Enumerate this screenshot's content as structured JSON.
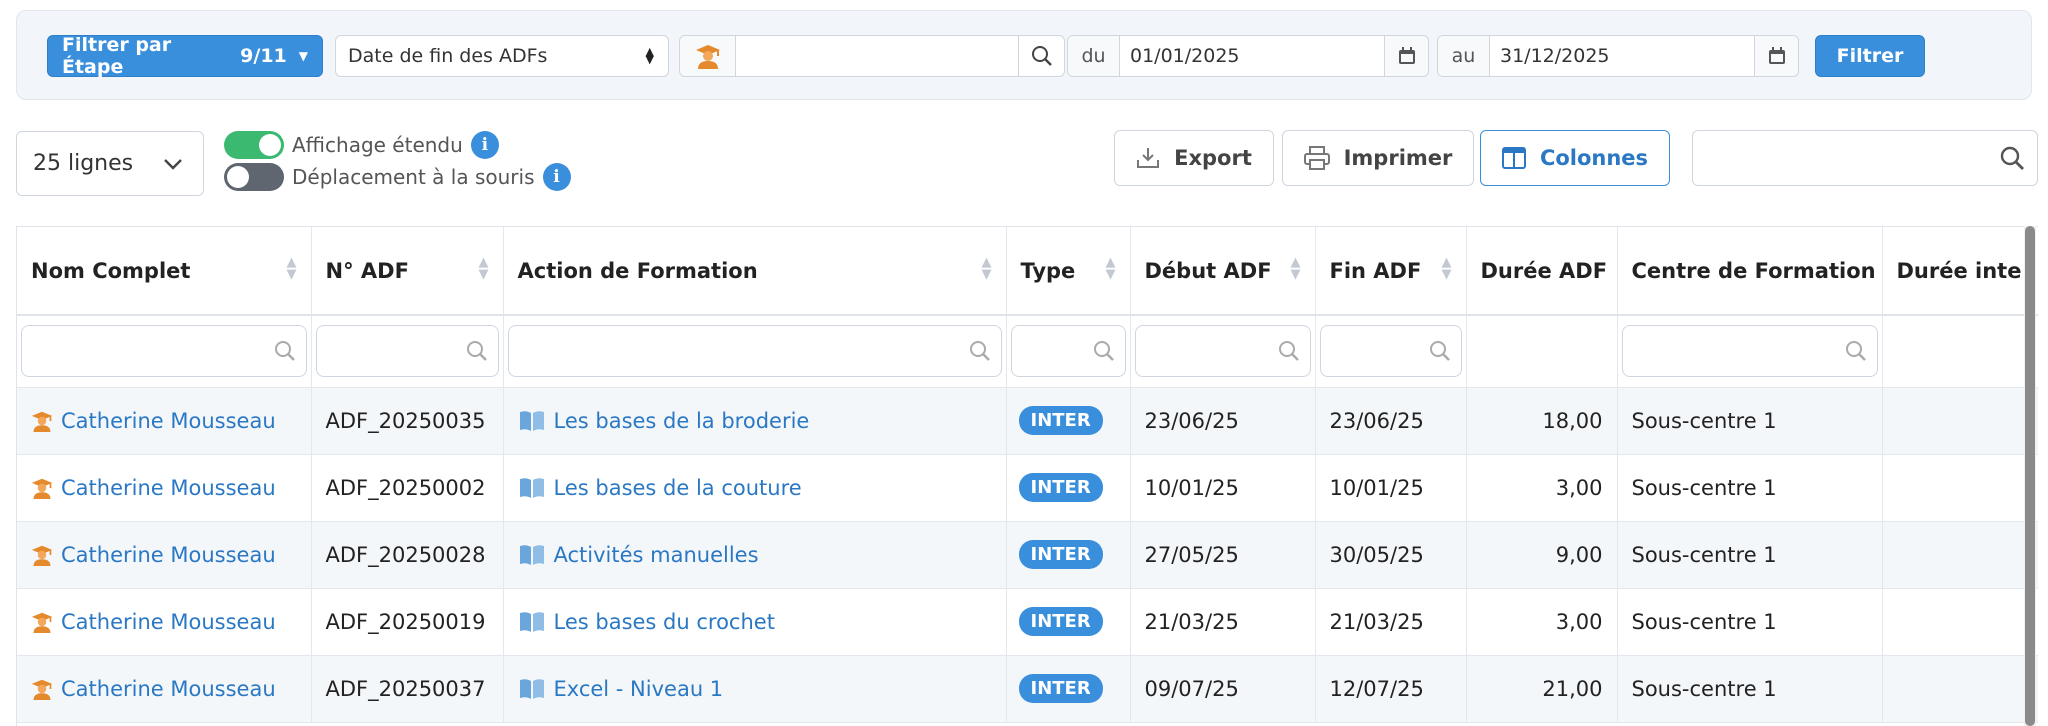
{
  "filter_bar": {
    "etape_label": "Filtrer par Étape",
    "etape_count": "9/11",
    "date_type_value": "Date de fin des ADFs",
    "user_search_value": "",
    "date_from_label": "du",
    "date_from_value": "01/01/2025",
    "date_to_label": "au",
    "date_to_value": "31/12/2025",
    "filter_button": "Filtrer"
  },
  "toolbar": {
    "rows_per_page": "25 lignes",
    "toggle_extended_label": "Affichage étendu",
    "toggle_extended_on": true,
    "toggle_mouse_label": "Déplacement à la souris",
    "toggle_mouse_on": false,
    "export_label": "Export",
    "print_label": "Imprimer",
    "columns_label": "Colonnes",
    "search_value": ""
  },
  "colors": {
    "accent": "#3a8fdd",
    "link": "#2a78c4",
    "toggle_on": "#3cb971",
    "user_icon": "#e58a2c",
    "book_icon": "#6aa6dc"
  },
  "table": {
    "columns": [
      {
        "label": "Nom Complet"
      },
      {
        "label": "N° ADF"
      },
      {
        "label": "Action de Formation"
      },
      {
        "label": "Type"
      },
      {
        "label": "Début ADF"
      },
      {
        "label": "Fin ADF"
      },
      {
        "label": "Durée ADF"
      },
      {
        "label": "Centre de Formation"
      },
      {
        "label": "Durée inte"
      }
    ],
    "rows": [
      {
        "name": "Catherine Mousseau",
        "adf": "ADF_20250035",
        "action": "Les bases de la broderie",
        "type": "INTER",
        "start": "23/06/25",
        "end": "23/06/25",
        "duration": "18,00",
        "center": "Sous-centre 1"
      },
      {
        "name": "Catherine Mousseau",
        "adf": "ADF_20250002",
        "action": "Les bases de la couture",
        "type": "INTER",
        "start": "10/01/25",
        "end": "10/01/25",
        "duration": "3,00",
        "center": "Sous-centre 1"
      },
      {
        "name": "Catherine Mousseau",
        "adf": "ADF_20250028",
        "action": "Activités manuelles",
        "type": "INTER",
        "start": "27/05/25",
        "end": "30/05/25",
        "duration": "9,00",
        "center": "Sous-centre 1"
      },
      {
        "name": "Catherine Mousseau",
        "adf": "ADF_20250019",
        "action": "Les bases du crochet",
        "type": "INTER",
        "start": "21/03/25",
        "end": "21/03/25",
        "duration": "3,00",
        "center": "Sous-centre 1"
      },
      {
        "name": "Catherine Mousseau",
        "adf": "ADF_20250037",
        "action": "Excel - Niveau 1",
        "type": "INTER",
        "start": "09/07/25",
        "end": "12/07/25",
        "duration": "21,00",
        "center": "Sous-centre 1"
      }
    ]
  }
}
